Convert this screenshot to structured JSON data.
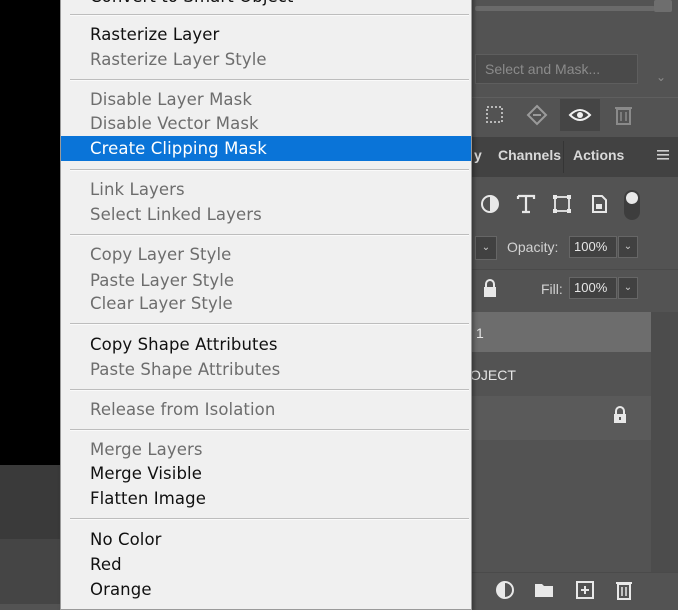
{
  "menu": {
    "partial_top": "Convert to Smart Object",
    "items": [
      {
        "label": "Rasterize Layer",
        "enabled": true
      },
      {
        "label": "Rasterize Layer Style",
        "enabled": false
      },
      {
        "label": "Disable Layer Mask",
        "enabled": false
      },
      {
        "label": "Disable Vector Mask",
        "enabled": false
      },
      {
        "label": "Create Clipping Mask",
        "enabled": true,
        "highlighted": true
      },
      {
        "label": "Link Layers",
        "enabled": false
      },
      {
        "label": "Select Linked Layers",
        "enabled": false
      },
      {
        "label": "Copy Layer Style",
        "enabled": false
      },
      {
        "label": "Paste Layer Style",
        "enabled": false
      },
      {
        "label": "Clear Layer Style",
        "enabled": false
      },
      {
        "label": "Copy Shape Attributes",
        "enabled": true
      },
      {
        "label": "Paste Shape Attributes",
        "enabled": false
      },
      {
        "label": "Release from Isolation",
        "enabled": false
      },
      {
        "label": "Merge Layers",
        "enabled": false
      },
      {
        "label": "Merge Visible",
        "enabled": true
      },
      {
        "label": "Flatten Image",
        "enabled": true
      },
      {
        "label": "No Color",
        "enabled": true
      },
      {
        "label": "Red",
        "enabled": true
      },
      {
        "label": "Orange",
        "enabled": true
      }
    ]
  },
  "properties": {
    "select_and_mask": "Select and Mask..."
  },
  "tabs": {
    "history_partial": "y",
    "channels": "Channels",
    "actions": "Actions"
  },
  "layers": {
    "opacity_label": "Opacity:",
    "opacity_value": "100%",
    "fill_label": "Fill:",
    "fill_value": "100%",
    "row1_partial": "1",
    "row2_partial": "OJECT"
  },
  "colors": {
    "highlight": "#0a74d8",
    "menu_bg": "#f0f0f0",
    "panel_bg": "#535353"
  }
}
